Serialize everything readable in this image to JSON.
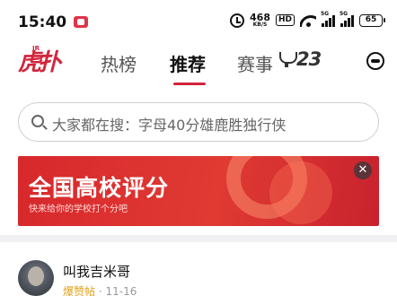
{
  "status_bar": {
    "time": "15:40",
    "net_speed": "468",
    "net_unit": "KB/S",
    "hd": "HD",
    "sig1_label": "5G",
    "sig2_label": "5G",
    "battery": "65"
  },
  "header": {
    "logo_text": "虎扑",
    "logo_sup": "JR",
    "tabs": [
      {
        "label": "热榜"
      },
      {
        "label": "推荐"
      },
      {
        "label": "赛事"
      }
    ],
    "active_tab": "推荐",
    "event_badge_number": "23",
    "accent_color": "#d2243b"
  },
  "search": {
    "placeholder": "大家都在搜：字母40分雄鹿胜独行侠"
  },
  "banner": {
    "title": "全国高校评分",
    "subtitle": "快来给你的学校打个分吧",
    "close_symbol": "✕"
  },
  "post": {
    "author": "叫我吉米哥",
    "source": "爆赞帖",
    "separator": "·",
    "date": "11-16"
  }
}
